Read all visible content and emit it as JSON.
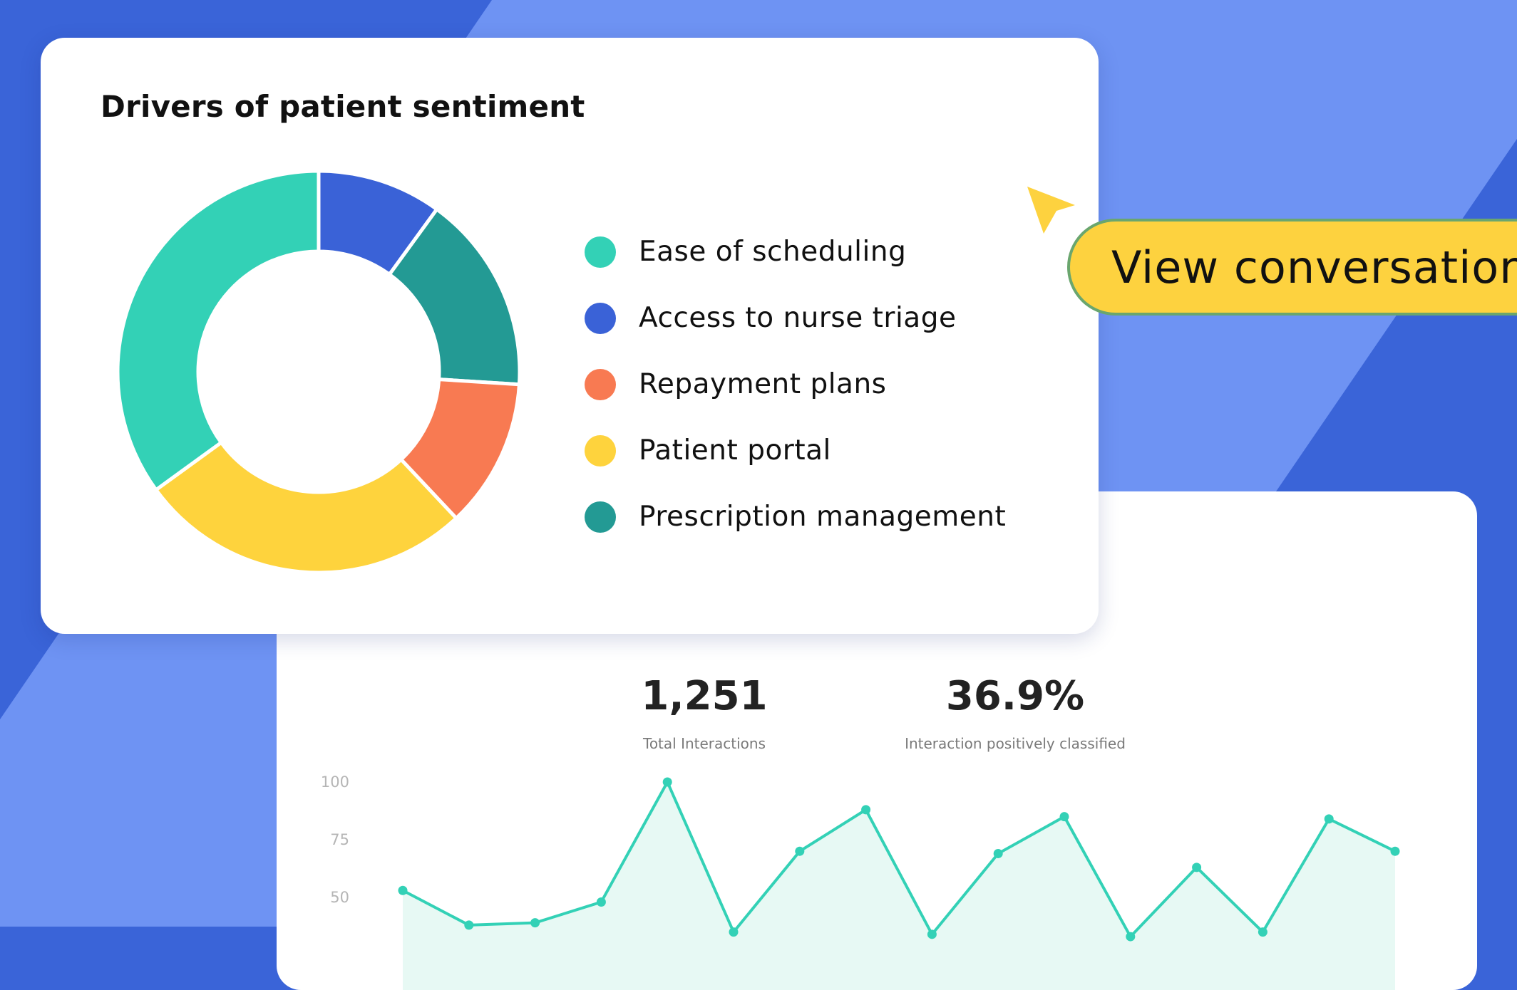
{
  "colors": {
    "background_dark": "#3a64d8",
    "background_light": "#6e93f3",
    "line_accent": "#33d1b6",
    "cta": "#fdd23f"
  },
  "donut_card": {
    "title": "Drivers of patient sentiment"
  },
  "stats": [
    {
      "value": "1,251",
      "label": "Total Interactions"
    },
    {
      "value": "36.9%",
      "label": "Interaction positively classified"
    }
  ],
  "cta": {
    "label": "View conversation"
  },
  "cursor_icon": "pointer-arrow-icon",
  "chart_data": [
    {
      "type": "pie",
      "variant": "donut",
      "title": "Drivers of patient sentiment",
      "categories": [
        "Access to nurse triage",
        "Prescription management",
        "Repayment plans",
        "Patient portal",
        "Ease of scheduling"
      ],
      "values": [
        10,
        16,
        12,
        27,
        35
      ],
      "colors": [
        "#3a62d7",
        "#239a94",
        "#f87a52",
        "#fed33d",
        "#33d1b6"
      ],
      "legend": {
        "position": "right",
        "items": [
          {
            "label": "Ease of scheduling",
            "color": "#33d1b6"
          },
          {
            "label": "Access to nurse triage",
            "color": "#3a62d7"
          },
          {
            "label": "Repayment plans",
            "color": "#f87a52"
          },
          {
            "label": "Patient portal",
            "color": "#fed33d"
          },
          {
            "label": "Prescription management",
            "color": "#239a94"
          }
        ]
      }
    },
    {
      "type": "area",
      "y_ticks": [
        "100",
        "75",
        "50"
      ],
      "ylim": [
        25,
        100
      ],
      "x_count": 15,
      "series": [
        {
          "values": [
            53,
            38,
            39,
            48,
            100,
            35,
            70,
            88,
            34,
            69,
            85,
            33,
            63,
            35,
            84,
            70
          ]
        }
      ],
      "x": [
        0,
        1,
        2,
        3,
        4,
        5,
        6,
        7,
        8,
        9,
        10,
        11,
        12,
        13,
        14,
        15
      ],
      "grid": false
    }
  ]
}
